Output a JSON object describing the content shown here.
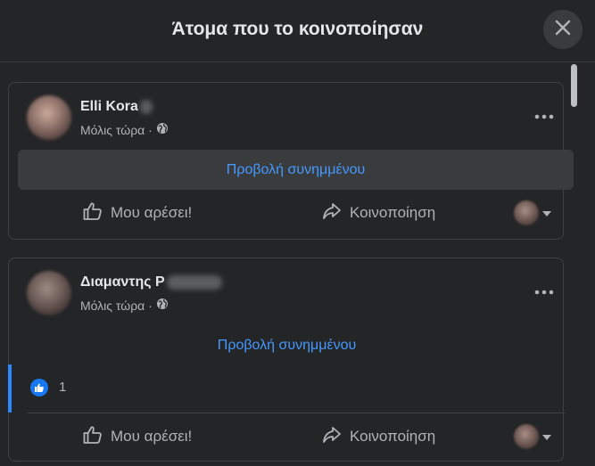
{
  "dialog": {
    "title": "Άτομα που το κοινοποίησαν"
  },
  "posts": [
    {
      "author": "Elli Kora",
      "time": "Μόλις τώρα ·",
      "attachment_link": "Προβολή συνημμένου",
      "like_label": "Μου αρέσει!",
      "share_label": "Κοινοποίηση"
    },
    {
      "author": "Διαμαντης Ρ",
      "time": "Μόλις τώρα ·",
      "attachment_link": "Προβολή συνημμένου",
      "reaction_count": "1",
      "like_label": "Μου αρέσει!",
      "share_label": "Κοινοποίηση"
    }
  ],
  "colors": {
    "background": "#242526",
    "link": "#4599ff",
    "accent": "#2d88ff",
    "like_badge": "#1877f2"
  }
}
